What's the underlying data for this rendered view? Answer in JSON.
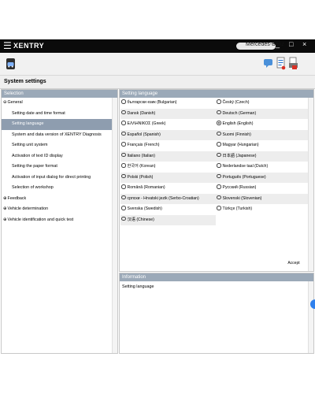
{
  "app": {
    "title": "XENTRY",
    "user": "Mercedes-Benz",
    "window_buttons": [
      "_",
      "□",
      "×"
    ]
  },
  "toolbar": {
    "icons": [
      "car-icon",
      "chat-icon",
      "document-icon",
      "print-icon"
    ]
  },
  "page": {
    "title": "System settings"
  },
  "left_panel": {
    "title": "Selection",
    "items": [
      {
        "label": "General",
        "prefix": "⊖",
        "level": 0
      },
      {
        "label": "Setting date and time format",
        "prefix": "",
        "level": 1
      },
      {
        "label": "Setting language",
        "prefix": "",
        "level": 1,
        "selected": true
      },
      {
        "label": "System and data version of XENTRY Diagnosis",
        "prefix": "",
        "level": 1
      },
      {
        "label": "Setting unit system",
        "prefix": "",
        "level": 1
      },
      {
        "label": "Activation of text ID display",
        "prefix": "",
        "level": 1
      },
      {
        "label": "Setting the paper format",
        "prefix": "",
        "level": 1
      },
      {
        "label": "Activation of input dialog for direct printing",
        "prefix": "",
        "level": 1
      },
      {
        "label": "Selection of workshop",
        "prefix": "",
        "level": 1
      },
      {
        "label": "Feedback",
        "prefix": "⊕",
        "level": 0
      },
      {
        "label": "Vehicle determination",
        "prefix": "⊕",
        "level": 0
      },
      {
        "label": "Vehicle identification and quick test",
        "prefix": "⊕",
        "level": 0
      }
    ]
  },
  "right_panel": {
    "title": "Setting language",
    "languages_left": [
      "български език (Bulgarian)",
      "Dansk (Danish)",
      "ΕΛΛΗΝΙΚΟΣ (Greek)",
      "Español (Spanish)",
      "Français (French)",
      "Italiano (Italian)",
      "한국어 (Korean)",
      "Polski (Polish)",
      "Română (Romanian)",
      "српски - Hrvatski jezik (Serbo-Croatian)",
      "Svenska (Swedish)",
      "汉语 (Chinese)"
    ],
    "languages_right": [
      "Český (Czech)",
      "Deutsch (German)",
      "English (English)",
      "Suomi (Finnish)",
      "Magyar (Hungarian)",
      "日本語 (Japanese)",
      "Nederlandse taal (Dutch)",
      "Português (Portuguese)",
      "Русский (Russian)",
      "Slovenski (Slovenian)",
      "Türkçe (Turkish)"
    ],
    "selected_language": "English (English)",
    "accept_label": "Accept"
  },
  "info_panel": {
    "title": "Information",
    "text": "Setting language"
  }
}
